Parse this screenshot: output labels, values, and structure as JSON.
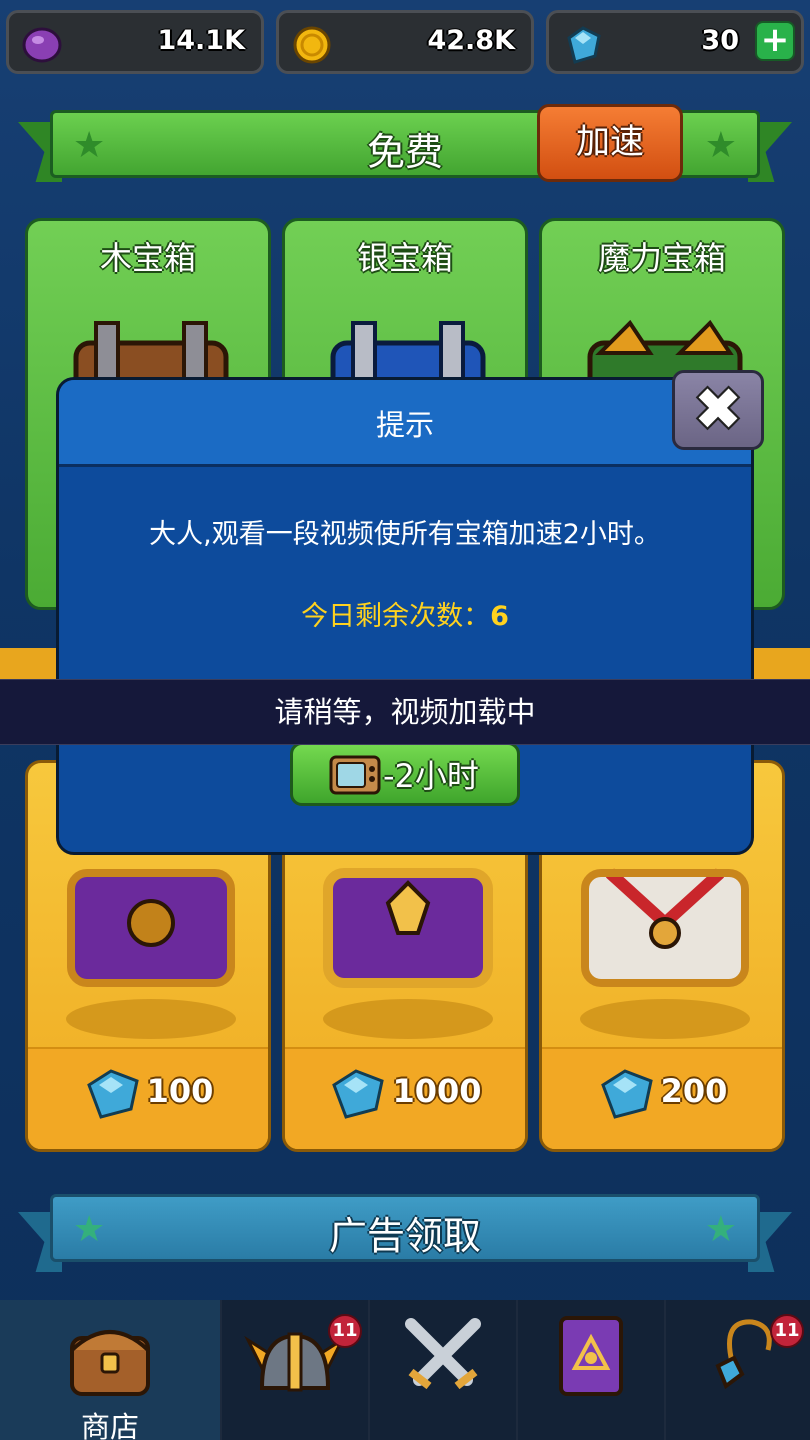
{
  "currency": {
    "potion": "14.1K",
    "gold": "42.8K",
    "gems": "30",
    "add_label": "+"
  },
  "free_section": {
    "title": "免费",
    "speed_button": "加速"
  },
  "free_chests": [
    {
      "name": "木宝箱"
    },
    {
      "name": "银宝箱"
    },
    {
      "name": "魔力宝箱"
    }
  ],
  "paid_chests": [
    {
      "price": "100"
    },
    {
      "price": "1000"
    },
    {
      "price": "200"
    }
  ],
  "ad_section": {
    "title": "广告领取"
  },
  "dialog": {
    "title": "提示",
    "message": "大人,观看一段视频使所有宝箱加速2小时。",
    "remaining_label": "今日剩余次数：",
    "remaining_count": "6",
    "watch_button": "-2小时",
    "close_label": "✖"
  },
  "toast": {
    "text": "请稍等，视频加载中"
  },
  "nav": {
    "shop_label": "商店",
    "heroes_badge": "11",
    "equipment_badge": "11"
  },
  "colors": {
    "background": "#0f3565",
    "dialog": "#0d4b9c",
    "free_ribbon": "#4fb53a",
    "speed_button": "#e2621f",
    "count_text": "#ffd21f",
    "badge": "#c2243a"
  },
  "icons": [
    "potion-icon",
    "gold-coin-icon",
    "gem-icon",
    "plus-icon",
    "star-icon",
    "close-icon",
    "tv-icon",
    "chest-icon",
    "helmet-icon",
    "crossed-swords-icon",
    "spellbook-icon",
    "amulet-icon"
  ]
}
